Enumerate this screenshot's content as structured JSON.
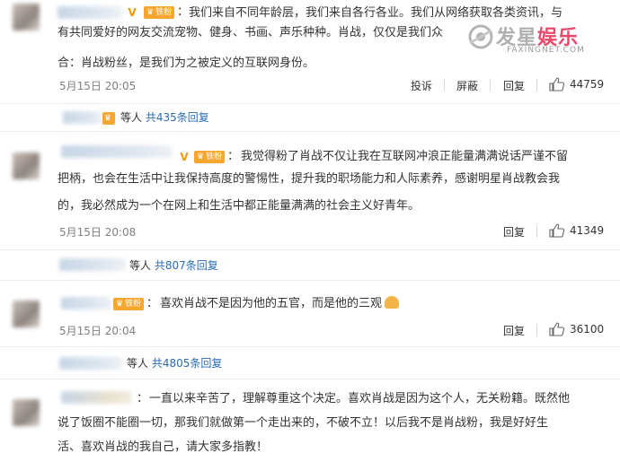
{
  "comments": [
    {
      "fan_badge": "铁粉",
      "text": "我们来自不同年龄层，我们来自各行各业。我们从网络获取各类资讯，与有共同爱好的网友交流宠物、健身、书画、声乐种种。肖战，仅仅是我们众多爱好中的一个交集罢了。合：肖战粉丝，是我们为之被定义的互联网身份。",
      "line1": "我们来自不同年龄层，我们来自各行各业。我们从网络获取各类资讯，与",
      "line2": "有共同爱好的网友交流宠物、健身、书画、声乐种种。肖战，仅仅是我们众",
      "line3": "合：肖战粉丝，是我们为之被定义的互联网身份。",
      "time": "5月15日 20:05",
      "report_label": "投诉",
      "block_label": "屏蔽",
      "reply_label": "回复",
      "likes": "44759",
      "reply_summary": {
        "who": "等人",
        "count": "共435条回复"
      }
    },
    {
      "fan_badge": "铁粉",
      "line1": "我觉得粉了肖战不仅让我在互联网冲浪正能量满满说话严谨不留",
      "line2": "把柄，也会在生活中让我保持高度的警惕性，提升我的职场能力和人际素养，感谢明星肖战教会我",
      "line3": "的，我必然成为一个在网上和生活中都正能量满满的社会主义好青年。",
      "time": "5月15日 20:08",
      "reply_label": "回复",
      "likes": "41349",
      "reply_summary": {
        "who": "等人",
        "count": "共807条回复"
      }
    },
    {
      "fan_badge": "铁粉",
      "line1": "喜欢肖战不是因为他的五官，而是他的三观",
      "time": "5月15日 20:04",
      "reply_label": "回复",
      "likes": "36100",
      "reply_summary": {
        "who": "等人",
        "count": "共4805条回复"
      }
    },
    {
      "line1": "一直以来辛苦了，理解尊重这个决定。喜欢肖战是因为这个人，无关粉籍。既然他",
      "line2": "说了饭圈不能圈一切，那我们就做第一个走出来的，不破不立！以后我不是肖战粉，我是好好生",
      "line3": "活、喜欢肖战的我自己，请大家多指教！"
    }
  ],
  "watermark": {
    "brand": "发星娱乐",
    "site": "FAXINGNET.COM"
  }
}
